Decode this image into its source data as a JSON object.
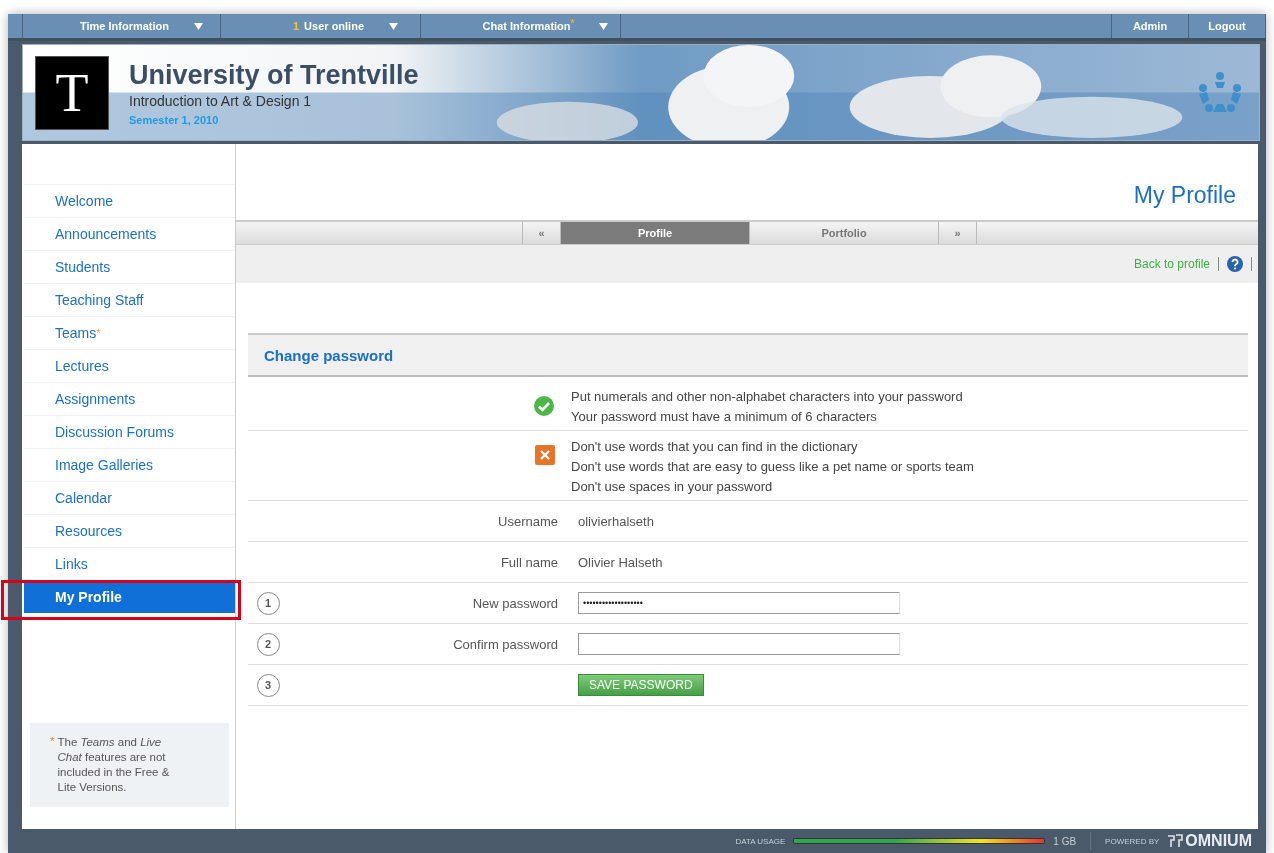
{
  "top_bar": {
    "menus": [
      {
        "label": "Time Information"
      },
      {
        "count": "1",
        "label": "User online"
      },
      {
        "label": "Chat Information",
        "note_mark": "*"
      }
    ],
    "links": [
      "Admin",
      "Logout"
    ]
  },
  "header": {
    "logo": "T",
    "title": "University of Trentville",
    "subtitle": "Introduction to Art & Design 1",
    "semester": "Semester 1, 2010"
  },
  "sidebar": {
    "items": [
      {
        "label": "Welcome",
        "selected": false
      },
      {
        "label": "Announcements",
        "selected": false
      },
      {
        "label": "Students",
        "selected": false
      },
      {
        "label": "Teaching Staff",
        "selected": false
      },
      {
        "label": "Teams",
        "selected": false,
        "note_mark": "*"
      },
      {
        "label": "Lectures",
        "selected": false
      },
      {
        "label": "Assignments",
        "selected": false
      },
      {
        "label": "Discussion Forums",
        "selected": false
      },
      {
        "label": "Image Galleries",
        "selected": false
      },
      {
        "label": "Calendar",
        "selected": false
      },
      {
        "label": "Resources",
        "selected": false
      },
      {
        "label": "Links",
        "selected": false
      },
      {
        "label": "My Profile",
        "selected": true
      }
    ],
    "footnote": {
      "mark": "*",
      "text": "The *Teams* and *Live Chat* features are not included in the Free & Lite Versions."
    }
  },
  "page_title": "My Profile",
  "tabs": [
    {
      "label": "«",
      "kind": "arrow",
      "selected": false
    },
    {
      "label": "Profile",
      "kind": "tab",
      "selected": true
    },
    {
      "label": "Portfolio",
      "kind": "tab",
      "selected": false
    },
    {
      "label": "»",
      "kind": "arrow",
      "selected": false
    }
  ],
  "back_link": "Back to profile",
  "section_title": "Change password",
  "rules": [
    {
      "kind": "do",
      "lines": [
        "Put numerals and other non-alphabet characters into your password",
        "Your password must have a minimum of 6 characters"
      ]
    },
    {
      "kind": "dont",
      "lines": [
        "Don't use words that you can find in the dictionary",
        "Don't use words that are easy to guess like a pet name or sports team",
        "Don't use spaces in your password"
      ]
    }
  ],
  "form": [
    {
      "kind": "info",
      "label": "Username",
      "value": "olivierhalseth"
    },
    {
      "kind": "info",
      "label": "Full name",
      "value": "Olivier Halseth"
    },
    {
      "kind": "input",
      "step": "1",
      "label": "New password",
      "value": "•••••••••••••••••••"
    },
    {
      "kind": "input",
      "step": "2",
      "label": "Confirm password"
    },
    {
      "kind": "button",
      "step": "3",
      "label": "SAVE PASSWORD"
    }
  ],
  "footer": {
    "usage_label": "DATA USAGE",
    "level": 1,
    "usage_value": "1 GB",
    "powered_by": "POWERED BY",
    "brand": "OMNIUM"
  }
}
